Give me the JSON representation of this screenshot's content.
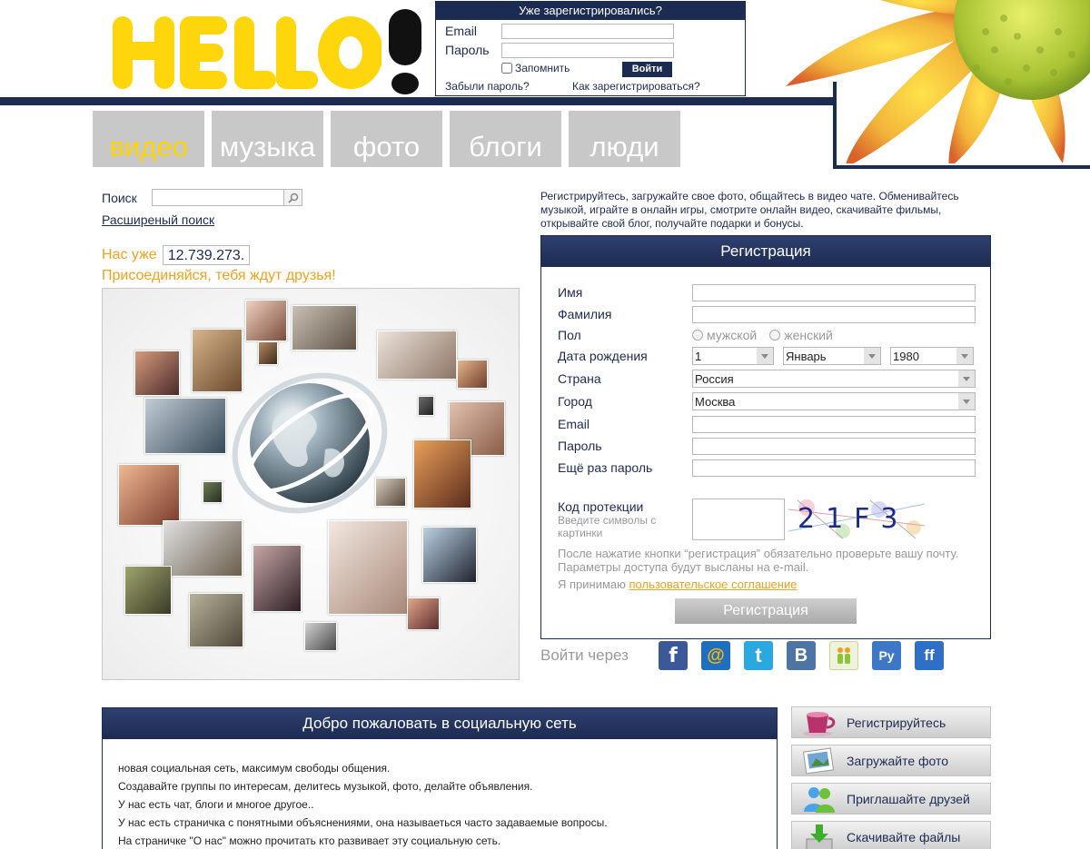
{
  "login": {
    "title": "Уже зарегистрировались?",
    "email_label": "Email",
    "password_label": "Пароль",
    "remember_label": "Запомнить",
    "submit_label": "Войти",
    "forgot_link": "Забыли пароль?",
    "howto_link": "Как зарегистрироваться?"
  },
  "nav": {
    "items": [
      {
        "label": "видео"
      },
      {
        "label": "музыка"
      },
      {
        "label": "фото"
      },
      {
        "label": "блоги"
      },
      {
        "label": "люди"
      }
    ]
  },
  "search": {
    "label": "Поиск",
    "advanced_link": "Расширеный поиск"
  },
  "stats": {
    "prefix": "Нас уже",
    "count": "12.739.273.",
    "join_text": "Присоединяйся, тебя ждут друзья!"
  },
  "promo": {
    "text": "Регистрируйтесь, загружайте свое фото, общайтесь в видео чате. Обменивайтесь музыкой, играйте в онлайн игры, смотрите онлайн видео, скачивайте фильмы, открывайте свой блог, получайте подарки и бонусы."
  },
  "registration": {
    "title": "Регистрация",
    "name_label": "Имя",
    "surname_label": "Фамилия",
    "gender_label": "Пол",
    "gender_male": "мужской",
    "gender_female": "женский",
    "birthdate_label": "Дата рождения",
    "birth_day": "1",
    "birth_month": "Январь",
    "birth_year": "1980",
    "country_label": "Страна",
    "country_value": "Россия",
    "city_label": "Город",
    "city_value": "Москва",
    "email_label": "Email",
    "password_label": "Пароль",
    "password_repeat_label": "Ещё раз пароль",
    "captcha_label": "Код протекции",
    "captcha_hint": "Введите символы с картинки",
    "captcha_code": "21F3",
    "note": "После нажатие кнопки “регистрация” обязательно проверьте вашу почту. Параметры доступа будут высланы на e-mail.",
    "agree_prefix": "Я принимаю",
    "agree_link": "пользовательское соглашение",
    "submit_label": "Регистрация"
  },
  "login_via": {
    "label": "Войти через",
    "providers": [
      {
        "name": "facebook-icon",
        "glyph": "f",
        "color": "#3b5998"
      },
      {
        "name": "mail-ru-icon",
        "glyph": "@",
        "color": "#1f6fc0"
      },
      {
        "name": "twitter-icon",
        "glyph": "t",
        "color": "#2aa9e0"
      },
      {
        "name": "vkontakte-icon",
        "glyph": "B",
        "color": "#4c75a3"
      },
      {
        "name": "odnoklassniki-icon",
        "glyph": "ok",
        "color": "#8fc43a"
      },
      {
        "name": "rambler-icon",
        "glyph": "Ру",
        "color": "#3d78c6"
      },
      {
        "name": "friendfeed-icon",
        "glyph": "ff",
        "color": "#2f6fc7"
      }
    ]
  },
  "welcome": {
    "title": "Добро пожаловать в социальную сеть",
    "lines": [
      "новая социальная сеть, максимум свободы общения.",
      "Создавайте группы по интересам, делитесь музыкой, фото, делайте объявления.",
      "У нас есть чат, блоги и многое другое..",
      "У нас есть страничка с понятными объяснениями, она называеться часто задаваемые вопросы.",
      "На страничке \"О нас\" можно прочитать кто развивает эту социальную сеть."
    ]
  },
  "side_buttons": [
    {
      "label": "Регистрируйтесь",
      "icon": "cup-icon"
    },
    {
      "label": "Загружайте фото",
      "icon": "photo-icon"
    },
    {
      "label": "Приглашайте друзей",
      "icon": "users-icon"
    },
    {
      "label": "Скачивайте файлы",
      "icon": "download-icon"
    }
  ]
}
